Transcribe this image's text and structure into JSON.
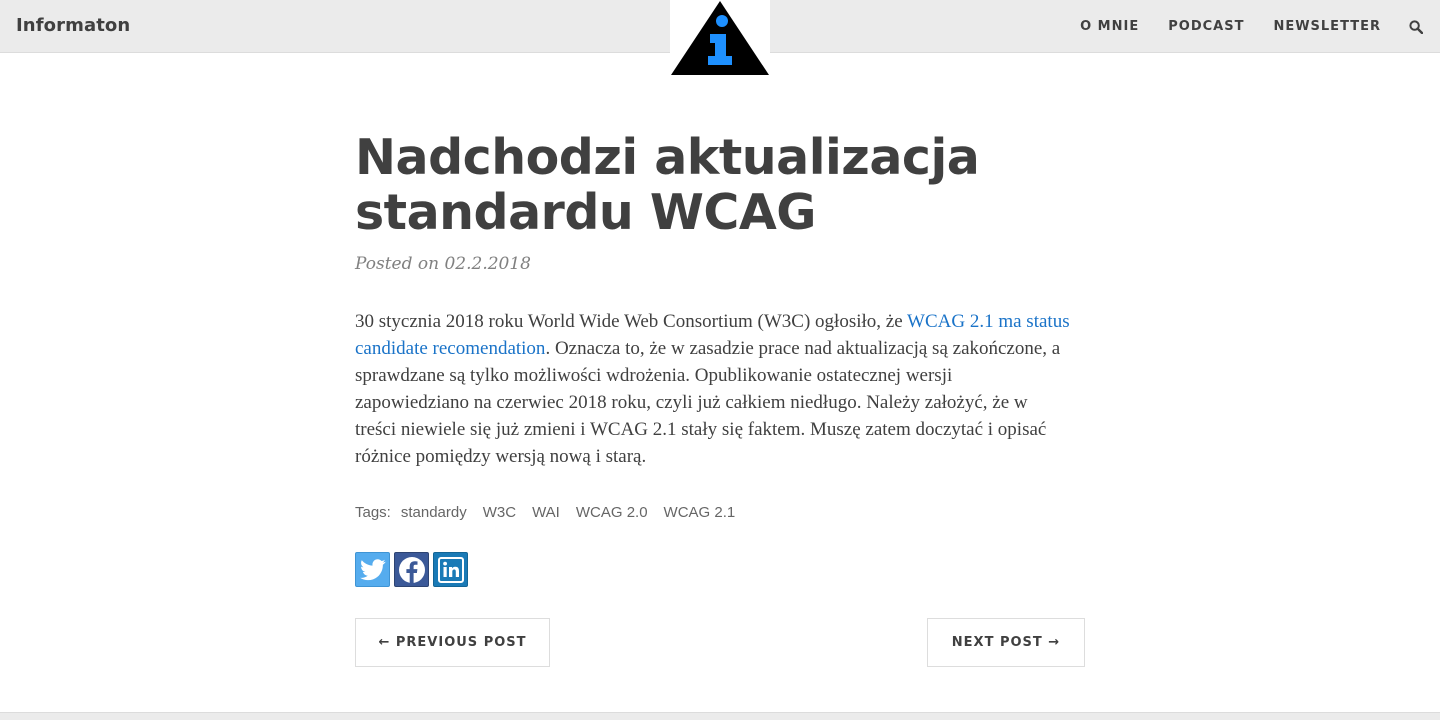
{
  "header": {
    "brand": "Informaton",
    "nav": [
      {
        "label": "O MNIE"
      },
      {
        "label": "PODCAST"
      },
      {
        "label": "NEWSLETTER"
      }
    ],
    "search_icon": "search-icon",
    "logo_icon": "info-triangle-icon"
  },
  "post": {
    "title": "Nadchodzi aktualizacja standardu WCAG",
    "meta": "Posted on 02.2.2018",
    "body_before_link": "30 stycznia 2018 roku World Wide Web Consortium (W3C) ogłosiło, że ",
    "link_text": "WCAG 2.1 ma status candidate recomendation",
    "body_after_link": ". Oznacza to, że w zasadzie prace nad aktualizacją są zakończone, a sprawdzane są tylko możliwości wdrożenia. Opublikowanie ostatecznej wersji zapowiedziano na czerwiec 2018 roku, czyli już całkiem niedługo. Należy założyć, że w treści niewiele się już zmieni i WCAG 2.1 stały się faktem. Muszę zatem doczytać i opisać różnice pomiędzy wersją nową i starą.",
    "tags_label": "Tags:",
    "tags": [
      "standardy",
      "W3C",
      "WAI",
      "WCAG 2.0",
      "WCAG 2.1"
    ]
  },
  "share": {
    "twitter": "twitter-icon",
    "facebook": "facebook-icon",
    "linkedin": "linkedin-icon"
  },
  "pager": {
    "prev_label": "← PREVIOUS POST",
    "next_label": "NEXT POST →"
  },
  "colors": {
    "nav_bg": "#ebebeb",
    "text": "#404040",
    "link": "#1a73c8",
    "logo_accent": "#1e90ff"
  }
}
